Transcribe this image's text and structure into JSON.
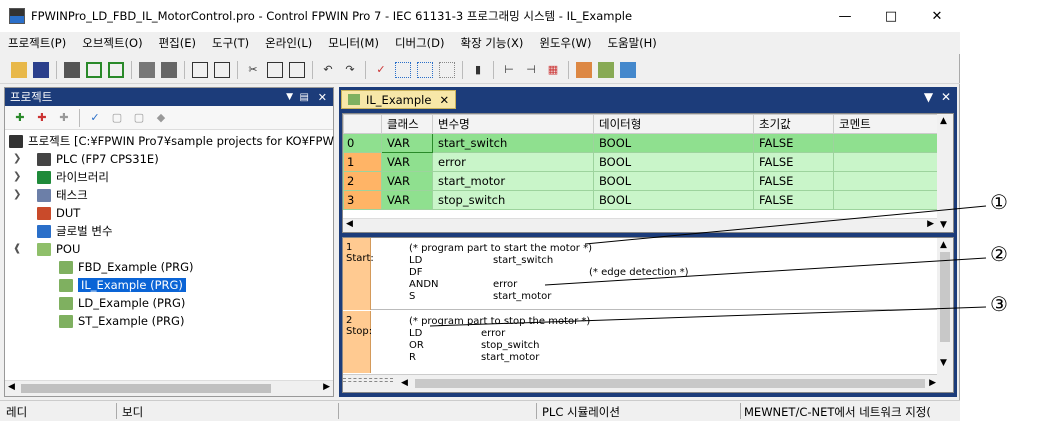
{
  "window": {
    "title": "FPWINPro_LD_FBD_IL_MotorControl.pro - Control FPWIN Pro 7 - IEC 61131-3 프로그래밍 시스템 - IL_Example"
  },
  "menu": [
    "프로젝트(P)",
    "오브젝트(O)",
    "편집(E)",
    "도구(T)",
    "온라인(L)",
    "모니터(M)",
    "디버그(D)",
    "확장 기능(X)",
    "윈도우(W)",
    "도움말(H)"
  ],
  "project_panel": {
    "title": "프로젝트",
    "tree": {
      "root": "프로젝트 [C:¥FPWIN Pro7¥sample projects for KO¥FPW",
      "plc": "PLC (FP7 CPS31E)",
      "library": "라이브러리",
      "task": "태스크",
      "dut": "DUT",
      "global": "글로벌 변수",
      "pou": "POU",
      "pous": [
        "FBD_Example (PRG)",
        "IL_Example (PRG)",
        "LD_Example (PRG)",
        "ST_Example (PRG)"
      ]
    }
  },
  "editor": {
    "tab": "IL_Example",
    "columns": [
      "클래스",
      "변수명",
      "데이터형",
      "초기값",
      "코멘트"
    ],
    "rows": [
      {
        "idx": "0",
        "cls": "VAR",
        "name": "start_switch",
        "type": "BOOL",
        "init": "FALSE",
        "cmt": ""
      },
      {
        "idx": "1",
        "cls": "VAR",
        "name": "error",
        "type": "BOOL",
        "init": "FALSE",
        "cmt": ""
      },
      {
        "idx": "2",
        "cls": "VAR",
        "name": "start_motor",
        "type": "BOOL",
        "init": "FALSE",
        "cmt": ""
      },
      {
        "idx": "3",
        "cls": "VAR",
        "name": "stop_switch",
        "type": "BOOL",
        "init": "FALSE",
        "cmt": ""
      }
    ],
    "networks": [
      {
        "label_num": "1",
        "label": "Start:",
        "comment": "(* program part to start the motor *)",
        "lines": [
          [
            "LD",
            "start_switch",
            ""
          ],
          [
            "DF",
            "",
            "(* edge detection *)"
          ],
          [
            "ANDN",
            "error",
            ""
          ],
          [
            "S",
            "start_motor",
            ""
          ]
        ]
      },
      {
        "label_num": "2",
        "label": "Stop:",
        "comment": "(* program part to stop the motor *)",
        "lines": [
          [
            "LD",
            "error",
            ""
          ],
          [
            "OR",
            "stop_switch",
            ""
          ],
          [
            "R",
            "start_motor",
            ""
          ]
        ]
      }
    ]
  },
  "status": {
    "s1": "레디",
    "s2": "보디",
    "s3": "PLC 시뮬레이션",
    "s4": "MEWNET/C-NET에서 네트워크 지정("
  },
  "annotations": [
    "①",
    "②",
    "③"
  ]
}
